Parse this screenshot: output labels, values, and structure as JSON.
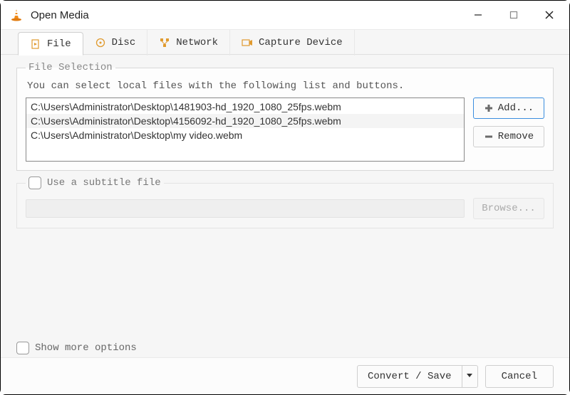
{
  "window": {
    "title": "Open Media"
  },
  "tabs": {
    "file": "File",
    "disc": "Disc",
    "network": "Network",
    "capture": "Capture Device"
  },
  "fileSelection": {
    "legend": "File Selection",
    "hint": "You can select local files with the following list and buttons.",
    "files": [
      "C:\\Users\\Administrator\\Desktop\\1481903-hd_1920_1080_25fps.webm",
      "C:\\Users\\Administrator\\Desktop\\4156092-hd_1920_1080_25fps.webm",
      "C:\\Users\\Administrator\\Desktop\\my video.webm"
    ],
    "addLabel": "Add...",
    "removeLabel": "Remove"
  },
  "subtitle": {
    "checkboxLabel": "Use a subtitle file",
    "browseLabel": "Browse..."
  },
  "options": {
    "showMore": "Show more options"
  },
  "actions": {
    "convertSave": "Convert / Save",
    "cancel": "Cancel"
  }
}
